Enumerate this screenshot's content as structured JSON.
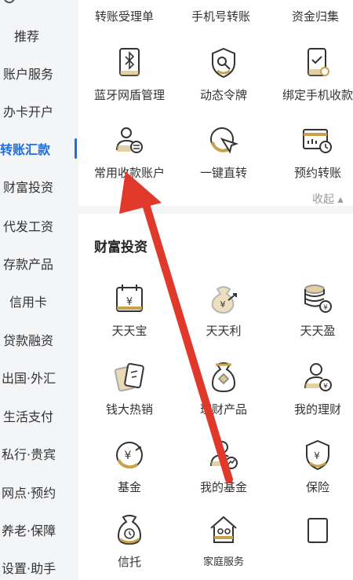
{
  "sidebar": {
    "items": [
      {
        "label": "推荐"
      },
      {
        "label": "账户服务"
      },
      {
        "label": "办卡开户"
      },
      {
        "label": "转账汇款",
        "active": true
      },
      {
        "label": "财富投资"
      },
      {
        "label": "代发工资"
      },
      {
        "label": "存款产品"
      },
      {
        "label": "信用卡"
      },
      {
        "label": "贷款融资"
      },
      {
        "label": "出国·外汇"
      },
      {
        "label": "生活支付"
      },
      {
        "label": "私行·贵宾"
      },
      {
        "label": "网点·预约"
      },
      {
        "label": "养老·保障"
      },
      {
        "label": "设置·助手"
      }
    ]
  },
  "transfer": {
    "top_row": [
      "转账受理单",
      "手机号转账",
      "资金归集"
    ],
    "grid": [
      {
        "label": "蓝牙网盾管理",
        "icon": "bluetooth-shield-icon"
      },
      {
        "label": "动态令牌",
        "icon": "dynamic-token-icon"
      },
      {
        "label": "绑定手机收款",
        "icon": "bind-phone-icon"
      },
      {
        "label": "常用收款账户",
        "icon": "payee-account-icon"
      },
      {
        "label": "一键直转",
        "icon": "one-click-transfer-icon"
      },
      {
        "label": "预约转账",
        "icon": "scheduled-transfer-icon"
      }
    ],
    "collapse_label": "收起"
  },
  "wealth": {
    "title": "财富投资",
    "grid": [
      {
        "label": "天天宝",
        "icon": "calendar-yuan-icon"
      },
      {
        "label": "天天利",
        "icon": "money-bag-growth-icon"
      },
      {
        "label": "天天盈",
        "icon": "coin-stack-icon"
      },
      {
        "label": "钱大热销",
        "icon": "hot-sale-cards-icon"
      },
      {
        "label": "理财产品",
        "icon": "wealth-bag-icon"
      },
      {
        "label": "我的理财",
        "icon": "my-wealth-icon"
      },
      {
        "label": "基金",
        "icon": "fund-icon"
      },
      {
        "label": "我的基金",
        "icon": "my-fund-icon"
      },
      {
        "label": "保险",
        "icon": "insurance-shield-icon"
      },
      {
        "label": "信托",
        "icon": "trust-bag-icon"
      },
      {
        "label": "家庭服务",
        "icon": "family-service-icon"
      }
    ]
  },
  "colors": {
    "accent": "#1d6fe0",
    "gold": "#c9a24a",
    "arrow": "#e0392b"
  }
}
